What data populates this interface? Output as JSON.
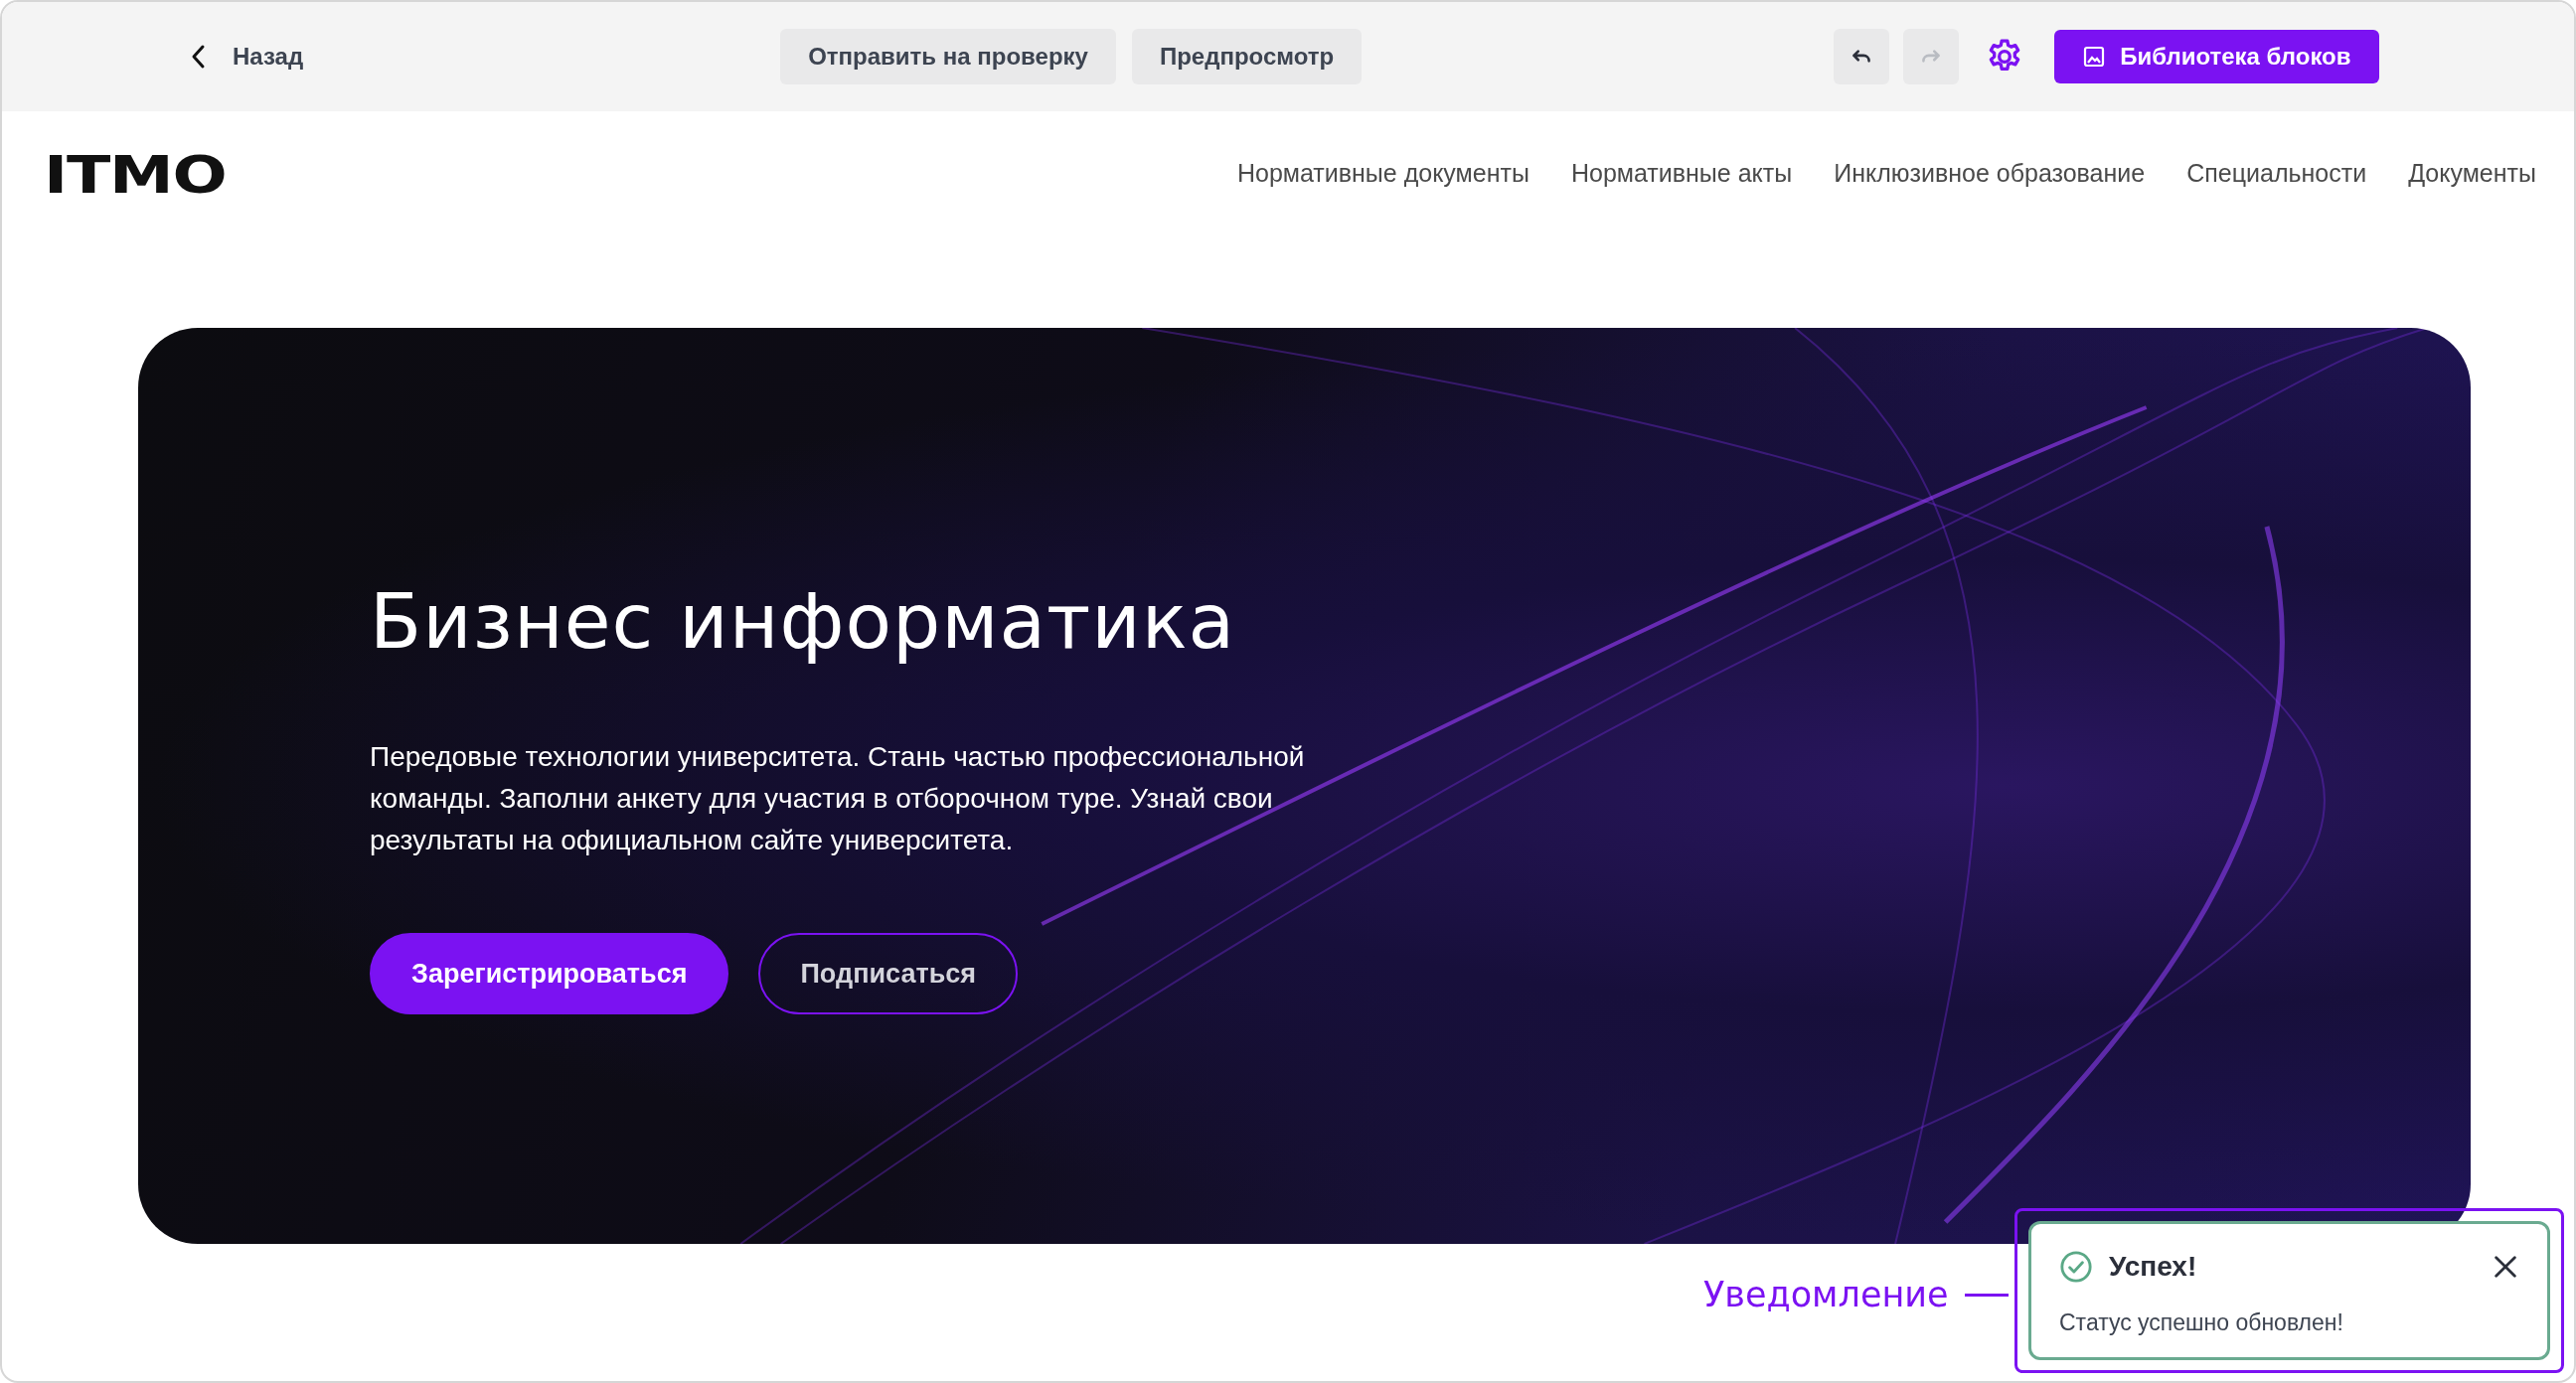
{
  "toolbar": {
    "back": {
      "label": "Назад"
    },
    "buttons": [
      {
        "label": "Отправить на проверку"
      },
      {
        "label": "Предпросмотр"
      }
    ],
    "history": [
      {
        "kind": "undo",
        "disabled": false
      },
      {
        "kind": "redo",
        "disabled": true
      }
    ],
    "library_button": {
      "label": "Библиотека блоков"
    }
  },
  "site": {
    "logo": "ITMO",
    "nav": [
      {
        "label": "Нормативные документы"
      },
      {
        "label": "Нормативные акты"
      },
      {
        "label": "Инклюзивное образование"
      },
      {
        "label": "Специальности"
      },
      {
        "label": "Документы"
      }
    ]
  },
  "hero": {
    "title": "Бизнес информатика",
    "text": "Передовые технологии университета. Стань частью профессиональной команды. Заполни анкету для участия в отборочном туре. Узнай свои результаты на официальном сайте университета.",
    "buttons": [
      {
        "label": "Зарегистрироваться",
        "kind": "primary"
      },
      {
        "label": "Подписаться",
        "kind": "outline"
      }
    ]
  },
  "annotation": {
    "label": "Уведомление"
  },
  "toast": {
    "title": "Успех!",
    "message": "Статус успешно обновлен!"
  }
}
